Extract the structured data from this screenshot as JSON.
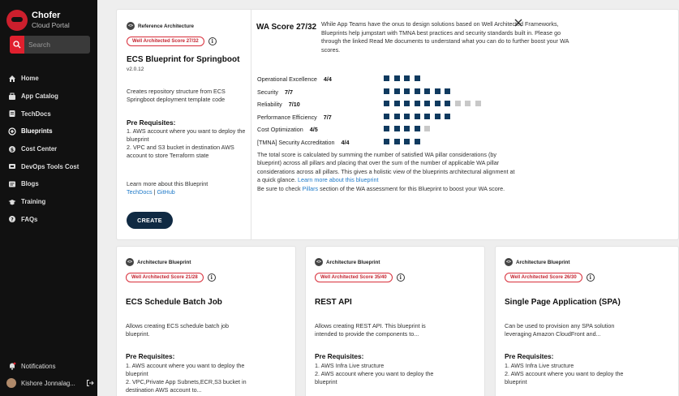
{
  "sidebar": {
    "brand_name": "Chofer",
    "brand_sub": "Cloud Portal",
    "search_placeholder": "Search",
    "items": [
      {
        "label": "Home",
        "icon": "home-icon"
      },
      {
        "label": "App Catalog",
        "icon": "catalog-icon"
      },
      {
        "label": "TechDocs",
        "icon": "docs-icon"
      },
      {
        "label": "Blueprints",
        "icon": "blueprint-icon",
        "active": true
      },
      {
        "label": "Cost Center",
        "icon": "cost-icon"
      },
      {
        "label": "DevOps Tools Cost",
        "icon": "devops-icon"
      },
      {
        "label": "Blogs",
        "icon": "blogs-icon"
      },
      {
        "label": "Training",
        "icon": "training-icon"
      },
      {
        "label": "FAQs",
        "icon": "faq-icon"
      }
    ],
    "notifications_label": "Notifications",
    "user_name": "Kishore Jonnalag..."
  },
  "main_card": {
    "type_label": "Reference Architecture",
    "badge": "Well Architected Score 27/32",
    "title": "ECS Blueprint for Springboot",
    "version": "v2.0.12",
    "description": "Creates repository structure from ECS Springboot deployment template code",
    "prereq_title": "Pre Requisites:",
    "prereq_1": "1. AWS account where you want to deploy the blueprint",
    "prereq_2": "2. VPC and S3 bucket in destination AWS account to store Terraform state",
    "learn_more": "Learn more about this Blueprint",
    "link_techdocs": "TechDocs",
    "link_sep": "|",
    "link_github": "GitHub",
    "create_label": "CREATE"
  },
  "wa_panel": {
    "title": "WA Score 27/32",
    "description": "While App Teams have the onus to design solutions based on Well Architected Frameworks, Blueprints help jumpstart with TMNA best practices and security standards built in. Please go through the linked Read Me documents to understand what you can do to further boost your WA scores.",
    "pillars": [
      {
        "name": "Operational Excellence",
        "score": "4/4",
        "achieved": 4,
        "total": 4
      },
      {
        "name": "Security",
        "score": "7/7",
        "achieved": 7,
        "total": 7
      },
      {
        "name": "Reliability",
        "score": "7/10",
        "achieved": 7,
        "total": 10
      },
      {
        "name": "Performance Efficiency",
        "score": "7/7",
        "achieved": 7,
        "total": 7
      },
      {
        "name": "Cost Optimization",
        "score": "4/5",
        "achieved": 4,
        "total": 5
      },
      {
        "name": "[TMNA] Security Accreditation",
        "score": "4/4",
        "achieved": 4,
        "total": 4
      }
    ],
    "total_text": "The total score is calculated by summing the number of satisfied WA pillar considerations (by blueprint) across all pillars and placing that over the sum of the number of applicable WA pillar considerations across all pillars. This gives a holistic view of the blueprints architectural alignment at a quick glance.",
    "total_link": "Learn more about this blueprint",
    "check_pre": "Be sure to check",
    "check_link": "Pillars",
    "check_post": "section of the WA assessment for this Blueprint to boost your WA score."
  },
  "cards": [
    {
      "type_label": "Architecture Blueprint",
      "badge": "Well Architected Score 21/28",
      "title": "ECS Schedule Batch Job",
      "description": "Allows creating ECS schedule batch job blueprint.",
      "prereq_title": "Pre Requisites:",
      "prereq_1": "1. AWS account where you want to deploy the blueprint",
      "prereq_2": "2. VPC,Private App Subnets,ECR,S3 bucket in destination AWS account to..."
    },
    {
      "type_label": "Architecture Blueprint",
      "badge": "Well Architected Score 35/40",
      "title": "REST API",
      "description": "Allows creating REST API. This blueprint is intended to provide the components to...",
      "prereq_title": "Pre Requisites:",
      "prereq_1": "1. AWS Infra Live structure",
      "prereq_2": "2. AWS account where you want to deploy the blueprint"
    },
    {
      "type_label": "Architecture Blueprint",
      "badge": "Well Architected Score 26/30",
      "title": "Single Page Application (SPA)",
      "description": "Can be used to provision any SPA solution leveraging Amazon CloudFront and...",
      "prereq_title": "Pre Requisites:",
      "prereq_1": "1. AWS Infra Live structure",
      "prereq_2": "2. AWS account where you want to deploy the blueprint"
    }
  ],
  "colors": {
    "sidebar_bg": "#111111",
    "accent_red": "#d82e3a",
    "navy": "#0f3a5f",
    "link_blue": "#1f7ac8"
  }
}
